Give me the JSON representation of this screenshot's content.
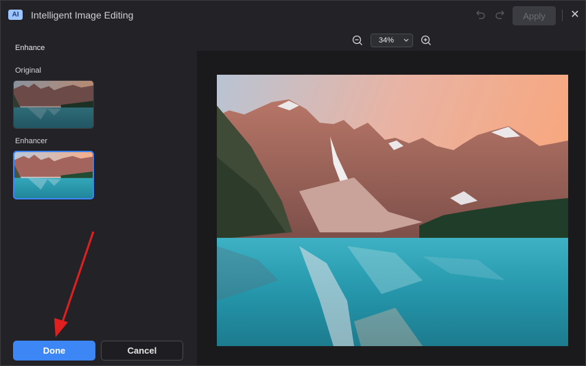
{
  "titlebar": {
    "badge": "AI",
    "title": "Intelligent Image Editing",
    "apply_label": "Apply",
    "close_glyph": "✕"
  },
  "icons": [
    "ai-badge-icon",
    "undo-icon",
    "redo-icon",
    "close-icon",
    "zoom-out-icon",
    "zoom-in-icon",
    "chevron-down-icon"
  ],
  "left_panel": {
    "section_title": "Enhance",
    "original_label": "Original",
    "enhancer_label": "Enhancer",
    "done_label": "Done",
    "cancel_label": "Cancel"
  },
  "zoom": {
    "value": "34%"
  },
  "colors": {
    "accent": "#3d86f6",
    "annotation_arrow": "#e02020"
  }
}
